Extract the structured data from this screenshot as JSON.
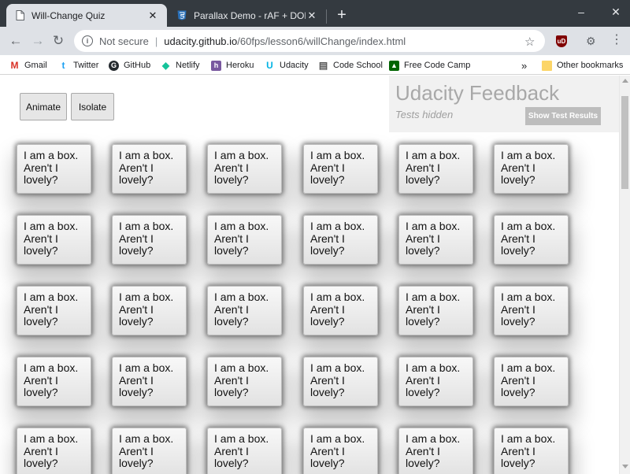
{
  "browser": {
    "tabs": [
      {
        "title": "Will-Change Quiz",
        "active": true,
        "icon": "page-icon"
      },
      {
        "title": "Parallax Demo - rAF + DOM + Wi",
        "active": false,
        "icon": "html5-icon"
      }
    ],
    "close_glyph": "✕",
    "new_tab_glyph": "+",
    "window_controls": {
      "minimize": "–",
      "maximize": "☐",
      "close": "✕"
    }
  },
  "toolbar": {
    "back": "←",
    "forward": "→",
    "reload": "↻",
    "info_glyph": "i",
    "security_label": "Not secure",
    "separator": "|",
    "url_host": "udacity.github.io",
    "url_path": "/60fps/lesson6/willChange/index.html",
    "star_glyph": "☆",
    "ublock_label": "uD",
    "ext2_glyph": "⚙",
    "menu_glyph": "⋮"
  },
  "bookmarks": [
    {
      "label": "Gmail",
      "icon": "gmail-icon",
      "color": "#d93025",
      "glyph": "M"
    },
    {
      "label": "Twitter",
      "icon": "twitter-icon",
      "color": "#1da1f2",
      "glyph": "t"
    },
    {
      "label": "GitHub",
      "icon": "github-icon",
      "color": "#24292e",
      "glyph": "G"
    },
    {
      "label": "Netlify",
      "icon": "netlify-icon",
      "color": "#15c39a",
      "glyph": "◆"
    },
    {
      "label": "Heroku",
      "icon": "heroku-icon",
      "color": "#79589f",
      "glyph": "h"
    },
    {
      "label": "Udacity",
      "icon": "udacity-icon",
      "color": "#02b3e4",
      "glyph": "U"
    },
    {
      "label": "Code School",
      "icon": "codeschool-icon",
      "color": "#ffffff",
      "glyph": "▤"
    },
    {
      "label": "Free Code Camp",
      "icon": "freecodecamp-icon",
      "color": "#006400",
      "glyph": "▲"
    }
  ],
  "bookmarks_overflow": "»",
  "other_bookmarks": "Other bookmarks",
  "page": {
    "animate_label": "Animate",
    "isolate_label": "Isolate",
    "feedback_title": "Udacity Feedback",
    "feedback_subtitle": "Tests hidden",
    "feedback_button": "Show Test Results",
    "box_line1": "I am a box.",
    "box_line2": "Aren't I",
    "box_line3": "lovely?"
  },
  "colors": {
    "tab_strip": "#343a40",
    "toolbar": "#dee1e6",
    "feedback_bg": "#f1f1f1"
  }
}
